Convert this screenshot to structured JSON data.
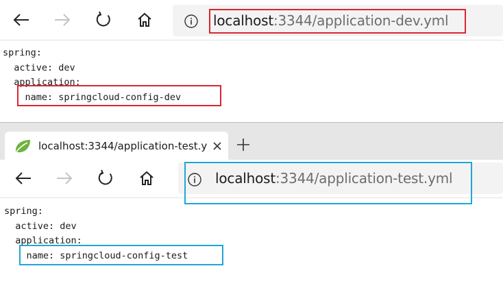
{
  "window1": {
    "address_bar": {
      "host": "localhost",
      "path": ":3344/application-dev.yml"
    },
    "content_lines": [
      "spring:",
      "  active: dev",
      "  application:",
      "    name: springcloud-config-dev"
    ],
    "icons": {
      "back": "back-arrow-icon",
      "forward": "forward-arrow-icon",
      "refresh": "refresh-icon",
      "home": "home-icon",
      "info": "info-icon"
    },
    "highlight_color": "#d9262e"
  },
  "window2": {
    "tab": {
      "title": "localhost:3344/application-test.y"
    },
    "address_bar": {
      "host": "localhost",
      "path": ":3344/application-test.yml"
    },
    "content_lines": [
      "spring:",
      "  active: dev",
      "  application:",
      "    name: springcloud-config-test"
    ],
    "icons": {
      "favicon": "spring-leaf-icon",
      "close": "close-icon",
      "new_tab": "plus-icon"
    },
    "highlight_color": "#1ea6d8"
  }
}
